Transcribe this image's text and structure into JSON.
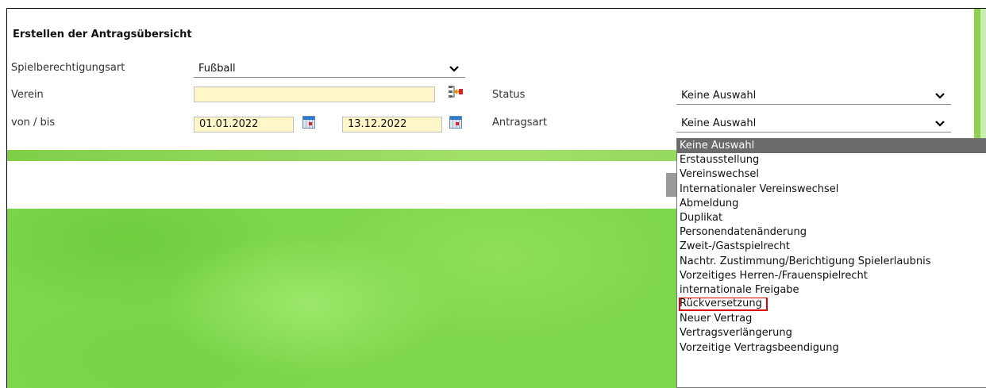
{
  "panel": {
    "title": "Erstellen der Antragsübersicht"
  },
  "form": {
    "spielberechtigungsart": {
      "label": "Spielberechtigungsart",
      "value": "Fußball"
    },
    "verein": {
      "label": "Verein",
      "value": ""
    },
    "von_bis": {
      "label": "von / bis",
      "from": "01.01.2022",
      "to": "13.12.2022"
    },
    "status": {
      "label": "Status",
      "value": "Keine Auswahl"
    },
    "antragsart": {
      "label": "Antragsart",
      "value": "Keine Auswahl"
    }
  },
  "dropdown": {
    "options": [
      "Keine Auswahl",
      "Erstausstellung",
      "Vereinswechsel",
      "Internationaler Vereinswechsel",
      "Abmeldung",
      "Duplikat",
      "Personendatenänderung",
      "Zweit-/Gastspielrecht",
      "Nachtr. Zustimmung/Berichtigung Spielerlaubnis",
      "Vorzeitiges Herren-/Frauenspielrecht",
      "internationale Freigabe",
      "Rückversetzung",
      "Neuer Vertrag",
      "Vertragsverlängerung",
      "Vorzeitige Vertragsbeendigung"
    ],
    "selected_index": 0,
    "highlighted_index": 11
  },
  "colors": {
    "accent_green": "#7ed64c",
    "highlight_border": "#e00000",
    "selected_option_bg": "#6b6b6b",
    "input_yellow": "#fff7c8"
  },
  "icons": {
    "select_arrow": "chevron-down-icon",
    "club_lookup": "club-lookup-icon",
    "date_picker": "calendar-icon"
  }
}
